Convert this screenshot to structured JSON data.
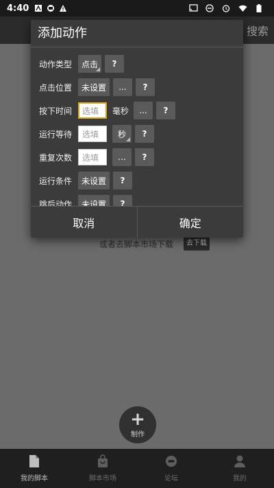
{
  "statusbar": {
    "time": "4:40"
  },
  "appbar": {
    "search": "搜索"
  },
  "background": {
    "market_text": "或者去脚本市场下载",
    "download_button": "去下载"
  },
  "fab": {
    "label": "制作"
  },
  "bottom_nav": [
    {
      "label": "我的脚本",
      "icon": "document-icon",
      "active": true
    },
    {
      "label": "脚本市场",
      "icon": "shopping-bag-icon",
      "active": false
    },
    {
      "label": "论坛",
      "icon": "forum-icon",
      "active": false
    },
    {
      "label": "我的",
      "icon": "person-icon",
      "active": false
    }
  ],
  "dialog": {
    "title": "添加动作",
    "rows": {
      "action_type": {
        "label": "动作类型",
        "value": "点击",
        "help": "?"
      },
      "click_position": {
        "label": "点击位置",
        "value": "未设置",
        "more": "...",
        "help": "?"
      },
      "press_time": {
        "label": "按下时间",
        "placeholder": "选填",
        "unit": "毫秒",
        "more": "...",
        "help": "?"
      },
      "run_wait": {
        "label": "运行等待",
        "placeholder": "选填",
        "unit": "秒",
        "help": "?"
      },
      "repeat_count": {
        "label": "重复次数",
        "placeholder": "选填",
        "more": "...",
        "help": "?"
      },
      "run_condition": {
        "label": "运行条件",
        "value": "未设置",
        "help": "?"
      },
      "partial_row": {
        "label": "跳后动作",
        "value": "未设置",
        "help": "?"
      }
    },
    "cancel": "取消",
    "confirm": "确定"
  }
}
